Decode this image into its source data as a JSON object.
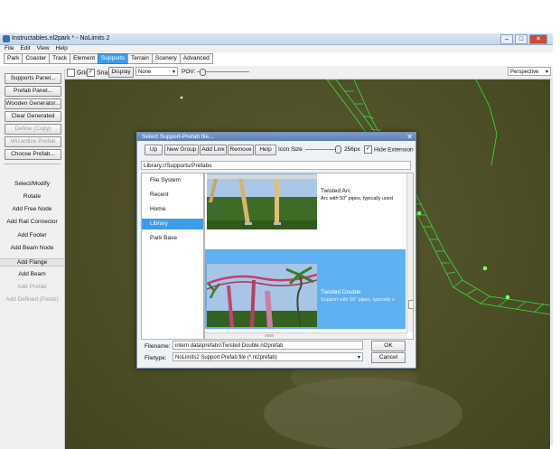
{
  "window": {
    "title": "Instructables.nl2park * - NoLimits 2"
  },
  "menu": [
    "File",
    "Edit",
    "View",
    "Help"
  ],
  "tabs": [
    {
      "label": "Park"
    },
    {
      "label": "Coaster"
    },
    {
      "label": "Track"
    },
    {
      "label": "Element"
    },
    {
      "label": "Supports",
      "active": true
    },
    {
      "label": "Terrain"
    },
    {
      "label": "Scenery"
    },
    {
      "label": "Advanced"
    }
  ],
  "toolbar": {
    "grid_label": "Grid",
    "grid_checked": false,
    "snap_label": "Snap",
    "snap_checked": true,
    "display_button": "Display",
    "none_select": "None",
    "pov_label": "POV:",
    "perspective_select": "Perspective"
  },
  "sidebar": {
    "buttons": [
      {
        "label": "Supports Panel...",
        "disabled": false
      },
      {
        "label": "Prefab Panel...",
        "disabled": false
      },
      {
        "label": "Wooden Generator...",
        "disabled": false
      },
      {
        "label": "Clear Generated",
        "disabled": false
      },
      {
        "label": "Define (Copy)",
        "disabled": true
      },
      {
        "label": "Wizardize Prefab",
        "disabled": true
      },
      {
        "label": "Choose Prefab...",
        "disabled": false
      }
    ],
    "tools": [
      {
        "label": "Select/Modify",
        "disabled": false
      },
      {
        "label": "Rotate",
        "disabled": false
      },
      {
        "label": "Add Free Node",
        "disabled": false
      },
      {
        "label": "Add Rail Connector",
        "disabled": false
      },
      {
        "label": "Add Footer",
        "disabled": false
      },
      {
        "label": "Add Beam Node",
        "disabled": false
      },
      {
        "label": "Add Flange",
        "disabled": false
      },
      {
        "label": "Add Beam",
        "disabled": false
      },
      {
        "label": "Add Prefab",
        "disabled": true
      },
      {
        "label": "Add Defined (Paste)",
        "disabled": true
      }
    ]
  },
  "dialog": {
    "title": "Select Support-Prefab file...",
    "close_glyph": "✕",
    "buttons": {
      "up": "Up",
      "new_group": "New Group",
      "add_link": "Add Link",
      "remove": "Remove",
      "help": "Help"
    },
    "icon_size_label": "Icon Size",
    "icon_size_value": "256px",
    "hide_extension_label": "Hide Extension",
    "hide_extension_checked": true,
    "path": "Library://Supports/Prefabs",
    "nav_items": [
      {
        "label": "File System",
        "selected": false
      },
      {
        "label": "Recent",
        "selected": false
      },
      {
        "label": "Home",
        "selected": false
      },
      {
        "label": "Library",
        "selected": true
      },
      {
        "label": "Park Base",
        "selected": false
      }
    ],
    "items": [
      {
        "title": "Twisted Arc",
        "desc": "Arc with 50\" pipes, typically used",
        "selected": false
      },
      {
        "title": "Twisted Double",
        "desc": "Support with 50\" pipes, typically u",
        "selected": true
      }
    ],
    "filename_label": "Filename:",
    "filename_value": "intern data\\prefabs\\Twisted Double.nl2prefab",
    "filetype_label": "Filetype:",
    "filetype_value": "NoLimits2 Support Prefab file (*.nl2prefab)",
    "ok_label": "OK",
    "cancel_label": "Cancel"
  },
  "colors": {
    "accent": "#3d9ee8",
    "track_green": "#38e03a",
    "ground": "#4e5028"
  }
}
